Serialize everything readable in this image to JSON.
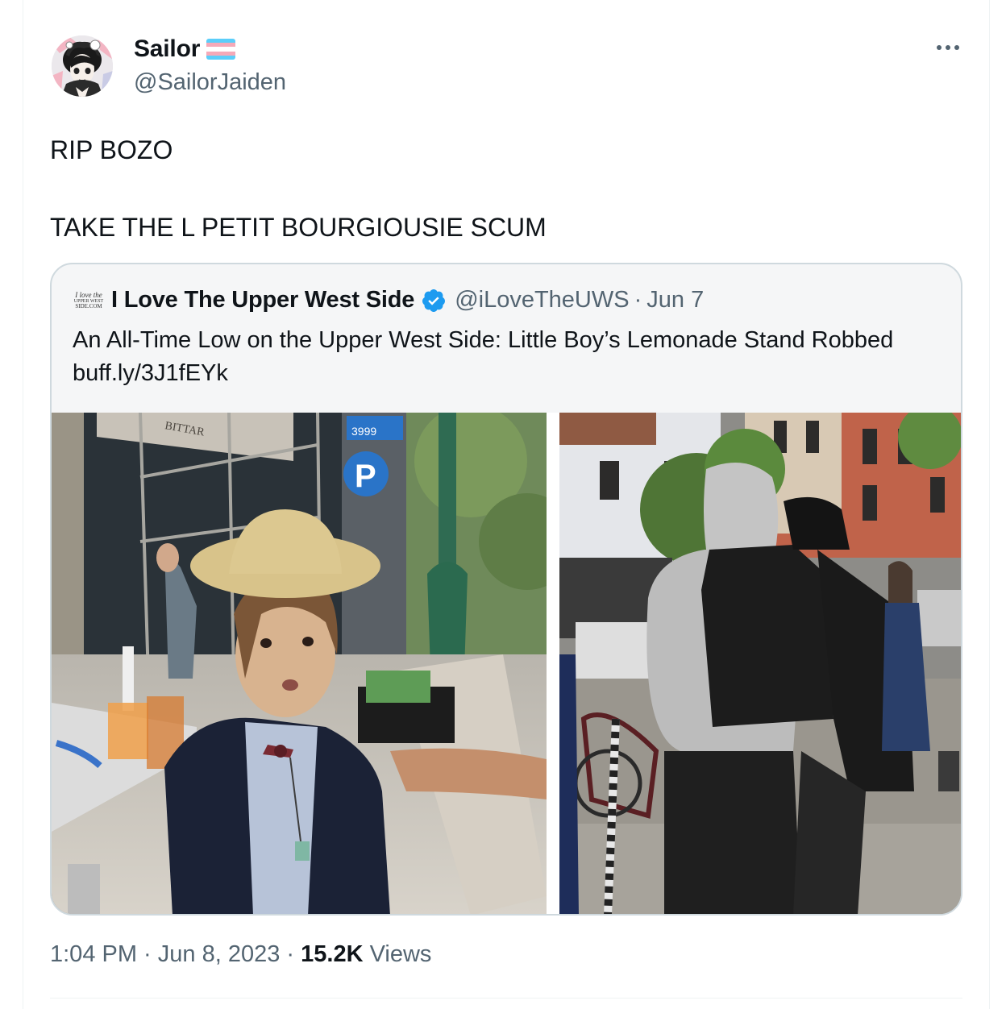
{
  "author": {
    "display_name": "Sailor",
    "handle": "@SailorJaiden",
    "flag_colors": [
      "#5bcefa",
      "#f5a9b8",
      "#ffffff",
      "#f5a9b8",
      "#5bcefa"
    ]
  },
  "tweet": {
    "text": "RIP BOZO\n\nTAKE THE L PETIT BOURGIOUSIE SCUM"
  },
  "quoted_tweet": {
    "logo_lines": [
      "I love the",
      "UPPER WEST",
      "SIDE.COM"
    ],
    "display_name": "I Love The Upper West Side",
    "verified": true,
    "verified_color": "#1d9bf0",
    "handle": "@iLoveTheUWS",
    "separator": "·",
    "date": "Jun 7",
    "text_line1": "An All-Time Low on the Upper West Side: Little Boy’s Lemonade Stand Robbed",
    "text_line2": "buff.ly/3J1fEYk",
    "photos": [
      {
        "icon": "photo-crying-boy-lemonade-stand",
        "sign_number": "3999",
        "parking_letter": "P",
        "awning_text": "BITTAR"
      },
      {
        "icon": "photo-hooded-figures-street"
      }
    ]
  },
  "meta": {
    "time": "1:04 PM",
    "sep1": " · ",
    "date": "Jun 8, 2023",
    "sep2": " · ",
    "views_count": "15.2K",
    "views_label": " Views"
  },
  "icons": {
    "more": "more-horizontal-icon",
    "verified": "verified-badge-icon",
    "avatar": "avatar-anime-portrait"
  }
}
